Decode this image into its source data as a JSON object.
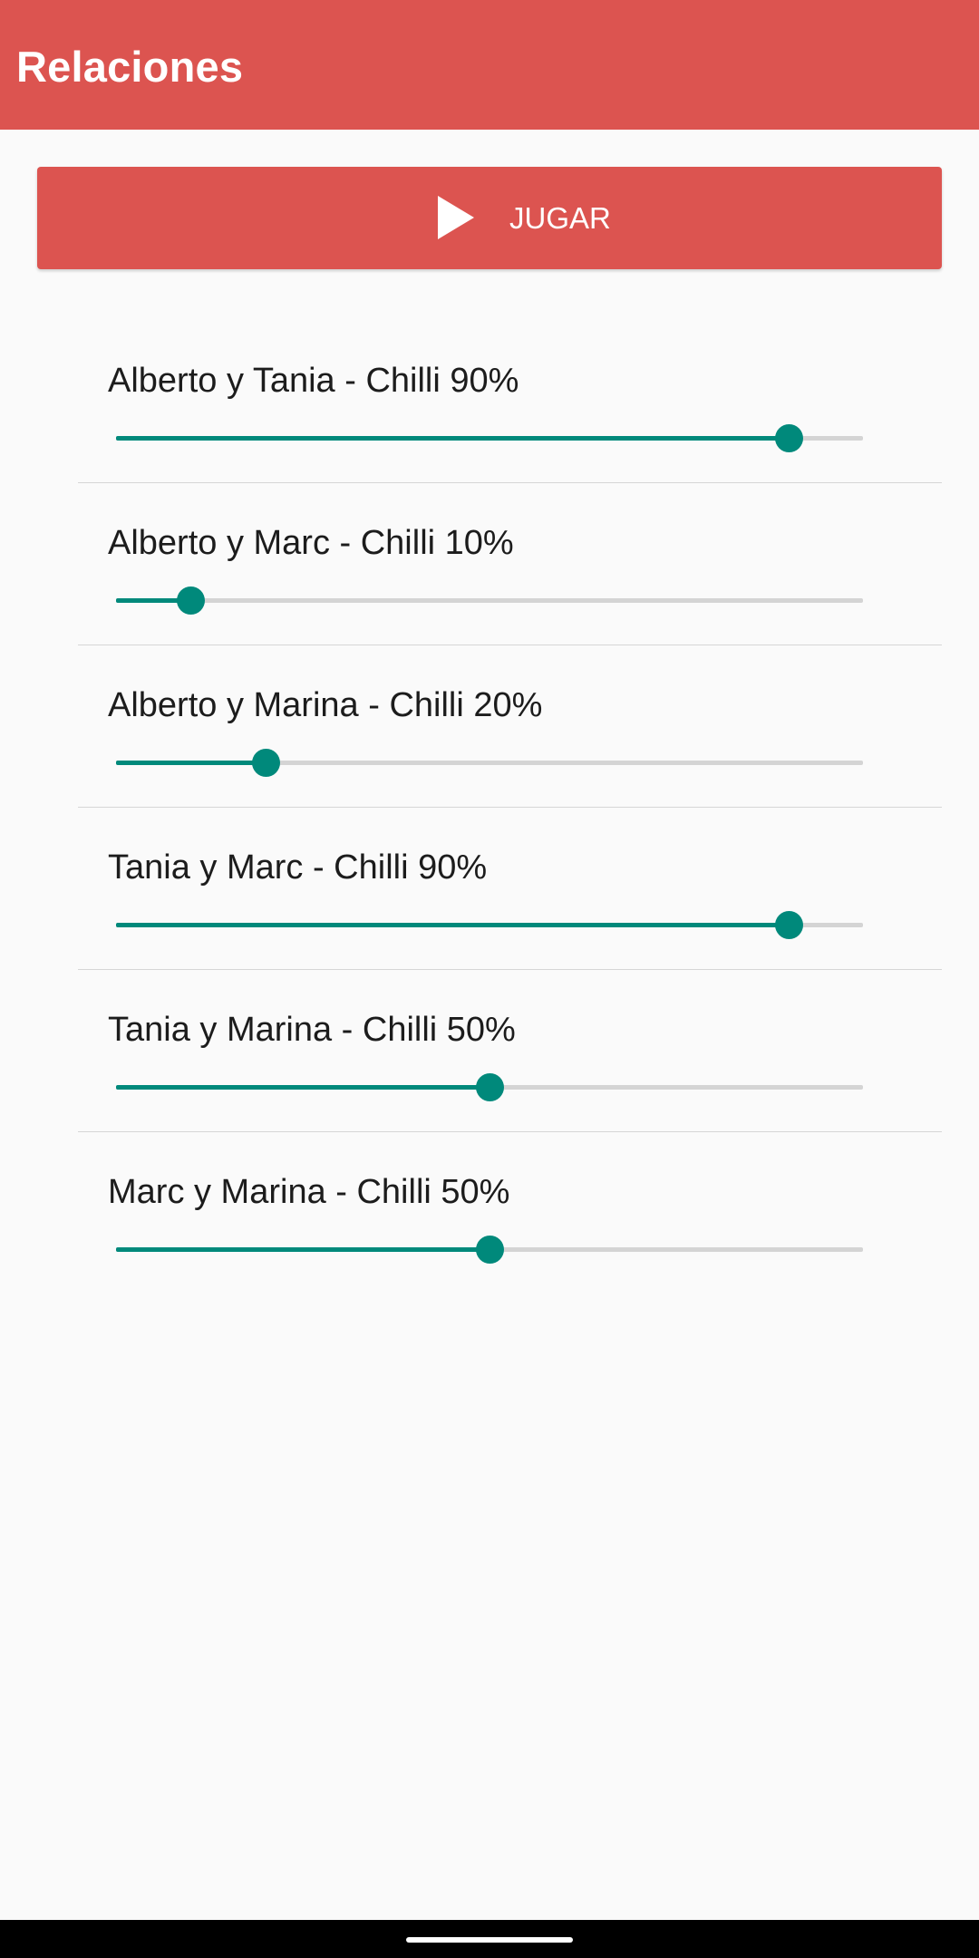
{
  "app_bar": {
    "title": "Relaciones",
    "color": "#dc5450"
  },
  "play_button": {
    "label": "JUGAR",
    "icon": "play-icon",
    "color": "#dc5450"
  },
  "accent_color": "#00897b",
  "relations": [
    {
      "label": "Alberto y Tania - Chilli 90%",
      "value": 90
    },
    {
      "label": "Alberto y Marc - Chilli 10%",
      "value": 10
    },
    {
      "label": "Alberto y Marina - Chilli 20%",
      "value": 20
    },
    {
      "label": "Tania y Marc - Chilli 90%",
      "value": 90
    },
    {
      "label": "Tania y Marina - Chilli 50%",
      "value": 50
    },
    {
      "label": "Marc y Marina - Chilli 50%",
      "value": 50
    }
  ],
  "nav": {
    "home_handle_icon": "home-handle-icon"
  }
}
